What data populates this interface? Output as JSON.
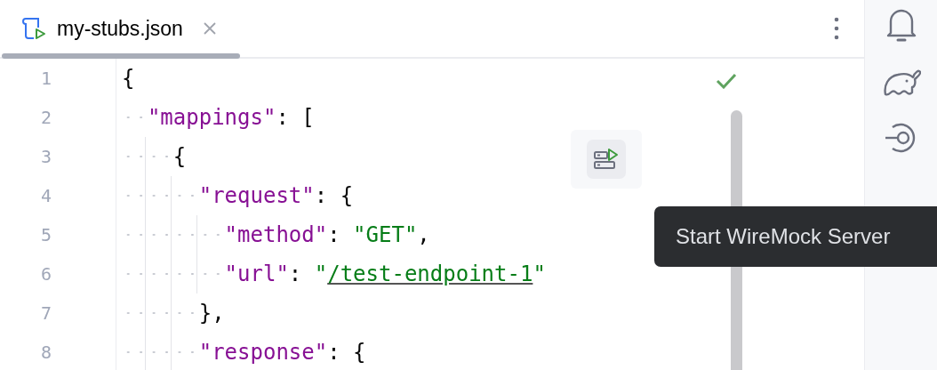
{
  "tabs": [
    {
      "label": "my-stubs.json",
      "selected": true
    }
  ],
  "editor": {
    "lines": [
      {
        "number": "1",
        "tokens": [
          {
            "kind": "punct",
            "text": "{"
          }
        ],
        "children": [
          {
            "number": "2",
            "tokens": [
              {
                "kind": "key",
                "text": "\"mappings\""
              },
              {
                "kind": "punct",
                "text": ": ["
              }
            ],
            "children": [
              {
                "number": "3",
                "tokens": [
                  {
                    "kind": "punct",
                    "text": "{"
                  }
                ],
                "children": [
                  {
                    "number": "4",
                    "tokens": [
                      {
                        "kind": "key",
                        "text": "\"request\""
                      },
                      {
                        "kind": "punct",
                        "text": ": {"
                      }
                    ],
                    "children": [
                      {
                        "number": "5",
                        "tokens": [
                          {
                            "kind": "key",
                            "text": "\"method\""
                          },
                          {
                            "kind": "punct",
                            "text": ": "
                          },
                          {
                            "kind": "string",
                            "text": "\"GET\""
                          },
                          {
                            "kind": "punct",
                            "text": ","
                          }
                        ]
                      },
                      {
                        "number": "6",
                        "tokens": [
                          {
                            "kind": "key",
                            "text": "\"url\""
                          },
                          {
                            "kind": "punct",
                            "text": ": "
                          },
                          {
                            "kind": "string",
                            "text": "\""
                          },
                          {
                            "kind": "link",
                            "text": "/test-endpoint-1"
                          },
                          {
                            "kind": "string",
                            "text": "\""
                          }
                        ]
                      }
                    ]
                  },
                  {
                    "number": "7",
                    "tokens": [
                      {
                        "kind": "punct",
                        "text": "},"
                      }
                    ]
                  },
                  {
                    "number": "8",
                    "tokens": [
                      {
                        "kind": "key",
                        "text": "\"response\""
                      },
                      {
                        "kind": "punct",
                        "text": ": {"
                      }
                    ]
                  }
                ]
              }
            ]
          }
        ]
      }
    ]
  },
  "tooltip": {
    "text": "Start WireMock Server"
  }
}
